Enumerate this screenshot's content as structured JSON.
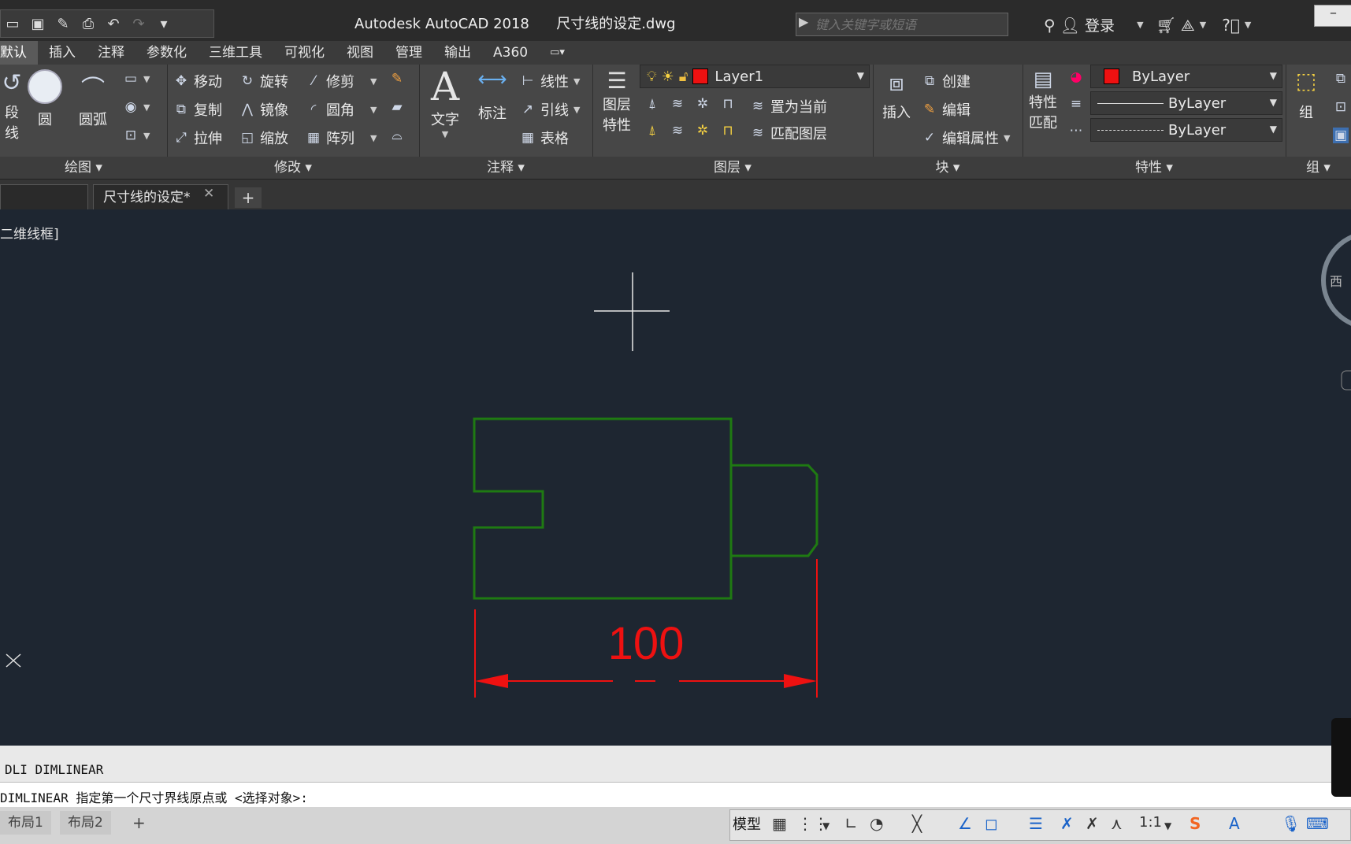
{
  "window": {
    "title": "Autodesk AutoCAD 2018      尺寸线的设定.dwg",
    "search_placeholder": "键入关键字或短语",
    "login_label": "登录",
    "minimize": "–"
  },
  "menu_tabs": [
    "默认",
    "插入",
    "注释",
    "参数化",
    "三维工具",
    "可视化",
    "视图",
    "管理",
    "输出",
    "A360"
  ],
  "ribbon": {
    "draw": {
      "title": "绘图",
      "polyline": "段线",
      "circle": "圆",
      "arc": "圆弧"
    },
    "modify": {
      "title": "修改",
      "move": "移动",
      "rotate": "旋转",
      "trim": "修剪",
      "copy": "复制",
      "mirror": "镜像",
      "fillet": "圆角",
      "stretch": "拉伸",
      "scale": "缩放",
      "array": "阵列"
    },
    "annotation": {
      "title": "注释",
      "text": "文字",
      "dimension": "标注",
      "linear": "线性",
      "leader": "引线",
      "table": "表格"
    },
    "layers": {
      "title": "图层",
      "properties_line1": "图层",
      "properties_line2": "特性",
      "current_layer": "Layer1",
      "set_current": "置为当前",
      "match_layer": "匹配图层"
    },
    "block": {
      "title": "块",
      "insert": "插入",
      "create": "创建",
      "edit": "编辑",
      "edit_attr": "编辑属性"
    },
    "properties": {
      "title": "特性",
      "match_line1": "特性",
      "match_line2": "匹配",
      "color": "ByLayer",
      "lineweight": "ByLayer",
      "linetype": "ByLayer"
    },
    "groups": {
      "title": "组",
      "group": "组"
    }
  },
  "doc_tabs": {
    "active": "尺寸线的设定*",
    "add": "+"
  },
  "viewport_label": "二维线框]",
  "drawing": {
    "dimension_text": "100",
    "shape_color": "#1f7a12",
    "dimension_color": "#ee1111",
    "compass_label": "西"
  },
  "command": {
    "history": "DLI DIMLINEAR",
    "prompt": "DIMLINEAR 指定第一个尺寸界线原点或 <选择对象>:"
  },
  "status": {
    "layout1": "布局1",
    "layout2": "布局2",
    "model": "模型",
    "scale": "1:1"
  }
}
